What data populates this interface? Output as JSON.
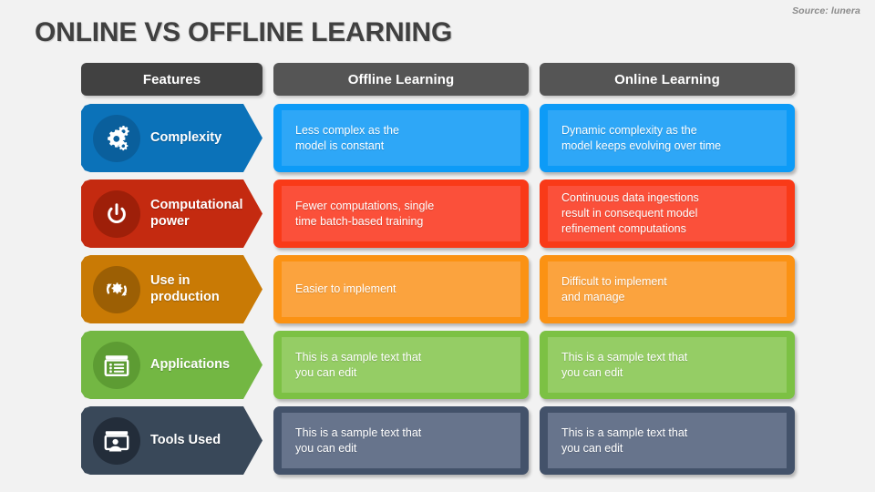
{
  "slide": {
    "title": "ONLINE VS OFFLINE LEARNING",
    "source": "Source: lunera",
    "background_color": "#f2f2f2",
    "title_color": "#404040"
  },
  "headers": {
    "features": "Features",
    "features_color": "#414141",
    "columns": [
      {
        "label": "Offline Learning",
        "color": "#555555"
      },
      {
        "label": "Online Learning",
        "color": "#555555"
      }
    ]
  },
  "rows": [
    {
      "feature": "Complexity",
      "icon": "gears-icon",
      "arrow_color": "#0b72b9",
      "icon_circle_color": "#0a5f9c",
      "cell_color": "#0d9bf7",
      "cell_inner_color": "#2ea7f7",
      "offline": "Less complex as the\nmodel is constant",
      "online": "Dynamic complexity as the\nmodel keeps evolving over time"
    },
    {
      "feature": "Computational\npower",
      "icon": "power-button-icon",
      "arrow_color": "#c42a10",
      "icon_circle_color": "#9e1f09",
      "cell_color": "#f93a18",
      "cell_inner_color": "#fb503a",
      "offline": "Fewer computations, single\ntime batch-based training",
      "online": "Continuous data ingestions\nresult in consequent model\nrefinement computations"
    },
    {
      "feature": "Use in\nproduction",
      "icon": "gear-refresh-icon",
      "arrow_color": "#c97a05",
      "icon_circle_color": "#9c5f04",
      "cell_color": "#fb9213",
      "cell_inner_color": "#fba33e",
      "offline": "Easier to implement",
      "online": "Difficult to implement\nand manage"
    },
    {
      "feature": "Applications",
      "icon": "list-window-icon",
      "arrow_color": "#73b743",
      "icon_circle_color": "#5d9c33",
      "cell_color": "#7cc144",
      "cell_inner_color": "#95cd65",
      "offline": "This is a sample text that\nyou can edit",
      "online": "This is a sample text that\nyou can edit"
    },
    {
      "feature": "Tools Used",
      "icon": "user-screen-icon",
      "arrow_color": "#394859",
      "icon_circle_color": "#232d3a",
      "cell_color": "#43526a",
      "cell_inner_color": "#667siebel",
      "offline": "This is a sample text that\nyou can edit",
      "online": "This is a sample text that\nyou can edit"
    }
  ]
}
